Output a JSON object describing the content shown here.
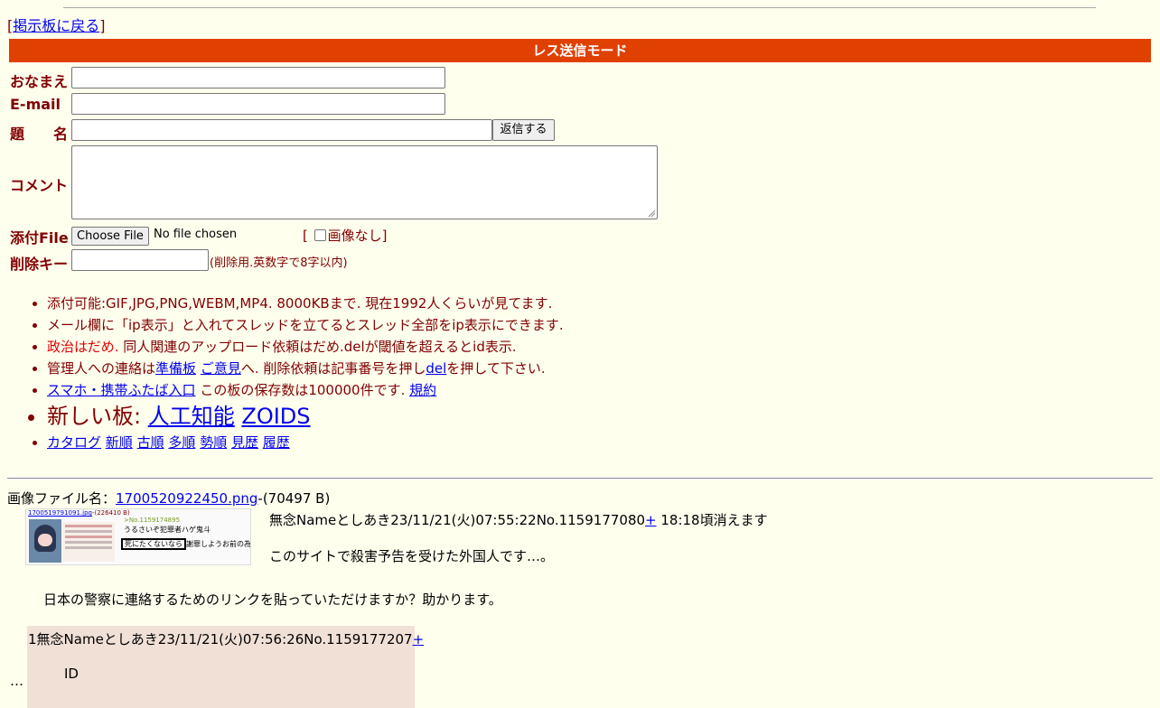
{
  "header": {
    "back_link": "掲示板に戻る",
    "bracket_open": "[",
    "bracket_close": "]",
    "mode_title": "レス送信モード"
  },
  "form": {
    "name_label": "おなまえ",
    "email_label": "E-mail",
    "subject_label": "題　　名",
    "submit_label": "返信する",
    "comment_label": "コメント",
    "file_label": "添付File",
    "choose_file_label": "Choose File",
    "no_file_text": "No file chosen",
    "no_image_open": "[",
    "no_image_label": "画像なし",
    "no_image_close": "]",
    "delete_key_label": "削除キー",
    "delete_key_hint": "(削除用.英数字で8字以内)"
  },
  "rules": {
    "line1": "添付可能:GIF,JPG,PNG,WEBM,MP4. 8000KBまで. 現在1992人くらいが見てます.",
    "line2": "メール欄に「ip表示」と入れてスレッドを立てるとスレッド全部をip表示にできます.",
    "line3_red": "政治はだめ.",
    "line3_rest": " 同人関連のアップロード依頼はだめ.delが閾値を超えるとid表示.",
    "line4_a": "管理人への連絡は",
    "line4_link1": "準備板",
    "line4_link2": "ご意見",
    "line4_b": "へ. 削除依頼は記事番号を押し",
    "line4_link3": "del",
    "line4_c": "を押して下さい.",
    "line5_link1": "スマホ・携帯ふたば入口",
    "line5_text": " この板の保存数は100000件です.",
    "line5_link2": "規約",
    "new_boards_label": "新しい板:",
    "new_board_1": "人工知能",
    "new_board_2": "ZOIDS",
    "nav": [
      "カタログ",
      "新順",
      "古順",
      "多順",
      "勢順",
      "見歴",
      "履歴"
    ]
  },
  "thread": {
    "file_label": "画像ファイル名：",
    "file_name": "1700520922450.png",
    "file_size": "-(70497 B)",
    "op_header": "無念Nameとしあき23/11/21(火)07:55:22No.1159177080",
    "op_plus": "+",
    "op_expire": " 18:18頃消えます",
    "op_body_1": "このサイトで殺害予告を受けた外国人です…。",
    "op_body_2": "日本の警察に連絡するためのリンクを貼っていただけますか？助かります。",
    "thumb_file": "1700519791091.jpg",
    "thumb_size": "-(226410 B)",
    "thumb_no": ">No.1159174895",
    "thumb_quote": "うるさいぞ犯罪者ハゲ鬼斗",
    "thumb_boxed": "死にたくないなら",
    "thumb_rest": "謝罪しようお前の為だぞ？",
    "reply_mark": "…",
    "reply_header": "1無念Nameとしあき23/11/21(火)07:56:26No.1159177207",
    "reply_plus": "+",
    "reply_body": "ID"
  },
  "colors": {
    "background": "#ffffee",
    "accent_bar": "#e04000",
    "label": "#800000",
    "link": "#0000ee",
    "reply_bg": "#f0e0d6"
  }
}
